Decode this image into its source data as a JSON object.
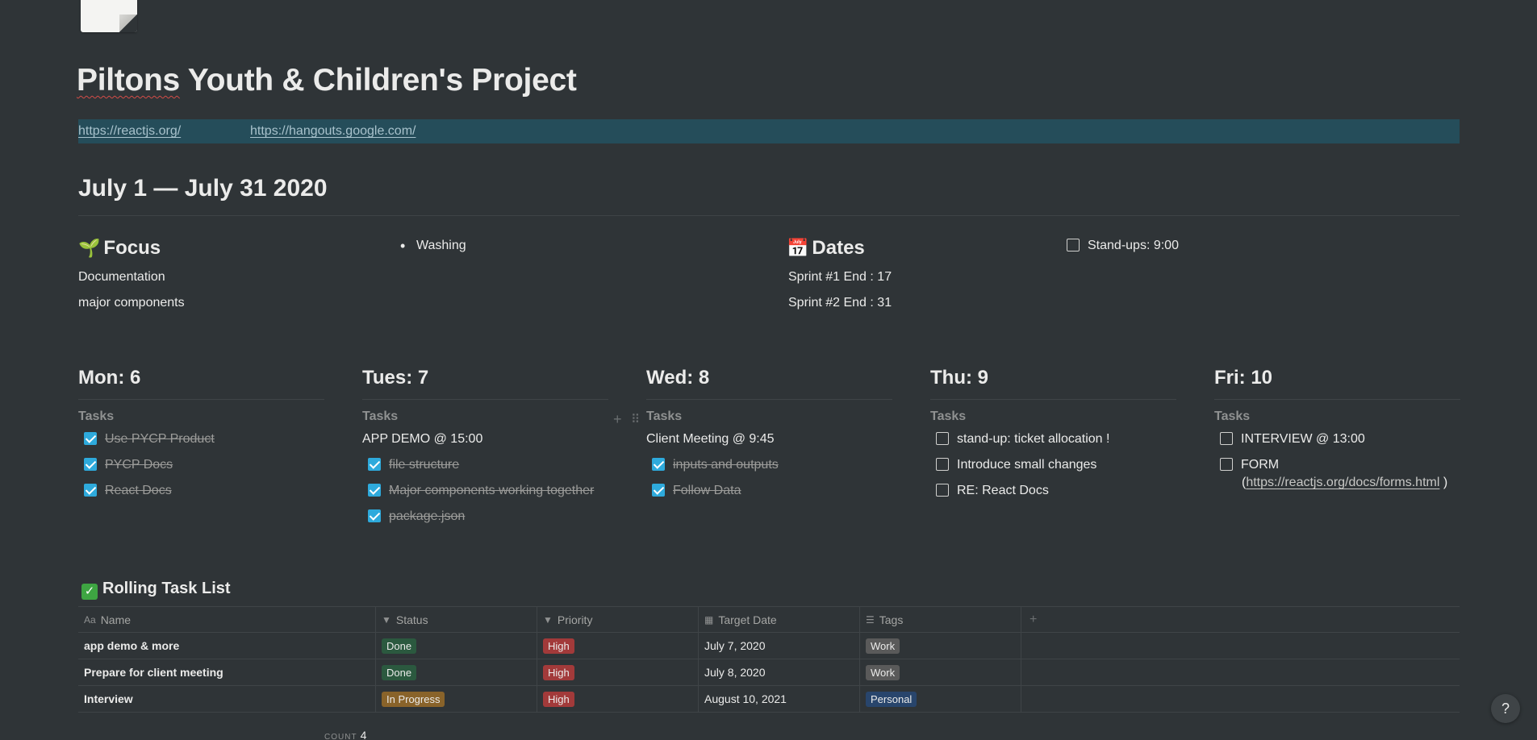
{
  "page": {
    "title_word1": "Piltons",
    "title_rest": " Youth & Children's Project"
  },
  "links": [
    "https://reactjs.org/",
    "https://hangouts.google.com/"
  ],
  "month_heading": "July 1 — July 31 2020",
  "focus": {
    "emoji": "🌱",
    "heading": "Focus",
    "lines": [
      "Documentation",
      "major components"
    ],
    "bullets": [
      "Washing"
    ]
  },
  "dates": {
    "emoji": "📅",
    "heading": "Dates",
    "lines": [
      "Sprint #1 End : 17",
      "Sprint #2 End : 31"
    ],
    "todo": {
      "label": "Stand-ups: 9:00",
      "checked": false
    }
  },
  "days": [
    {
      "day": "Mon: 6",
      "sub": "Tasks",
      "plain": [],
      "todos": [
        {
          "label": "Use PYCP Product",
          "checked": true
        },
        {
          "label": "PYCP Docs",
          "checked": true
        },
        {
          "label": "React Docs",
          "checked": true
        }
      ]
    },
    {
      "day": "Tues: 7",
      "sub": "Tasks",
      "plain": [
        "APP DEMO @ 15:00"
      ],
      "todos": [
        {
          "label": "file structure",
          "checked": true
        },
        {
          "label": "Major components working together",
          "checked": true
        },
        {
          "label": "package.json",
          "checked": true
        }
      ]
    },
    {
      "day": "Wed: 8",
      "sub": "Tasks",
      "plain": [
        "Client Meeting @ 9:45"
      ],
      "todos": [
        {
          "label": "inputs and outputs",
          "checked": true
        },
        {
          "label": "Follow Data",
          "checked": true
        }
      ]
    },
    {
      "day": "Thu: 9",
      "sub": "Tasks",
      "plain": [],
      "todos": [
        {
          "label": "stand-up: ticket allocation !",
          "checked": false
        },
        {
          "label": "Introduce small changes",
          "checked": false
        },
        {
          "label": "RE: React Docs",
          "checked": false
        }
      ]
    },
    {
      "day": "Fri: 10",
      "sub": "Tasks",
      "plain": [],
      "todos": [
        {
          "label": "INTERVIEW @ 13:00",
          "checked": false
        },
        {
          "label": "FORM",
          "checked": false
        }
      ],
      "form_link_open": "(",
      "form_link": "https://reactjs.org/docs/forms.html",
      "form_link_close": " )"
    }
  ],
  "rolling": {
    "heading": "Rolling Task List",
    "columns": [
      {
        "icon": "Aa",
        "label": "Name"
      },
      {
        "icon": "▼",
        "label": "Status"
      },
      {
        "icon": "▼",
        "label": "Priority"
      },
      {
        "icon": "▦",
        "label": "Target Date"
      },
      {
        "icon": "☰",
        "label": "Tags"
      }
    ],
    "add_column": "+",
    "rows": [
      {
        "name": "app demo & more",
        "status": "Done",
        "priority": "High",
        "date": "July 7, 2020",
        "tag": "Work"
      },
      {
        "name": "Prepare for client meeting",
        "status": "Done",
        "priority": "High",
        "date": "July 8, 2020",
        "tag": "Work"
      },
      {
        "name": "Interview",
        "status": "In Progress",
        "priority": "High",
        "date": "August 10, 2021",
        "tag": "Personal"
      }
    ],
    "count_label": "COUNT",
    "count_value": "4"
  },
  "colors": {
    "Done": "#2b593f",
    "In Progress": "#89632a",
    "High": "#a23a3a",
    "Work": "#5a5a5a",
    "Personal": "#28456c"
  },
  "help_label": "?"
}
